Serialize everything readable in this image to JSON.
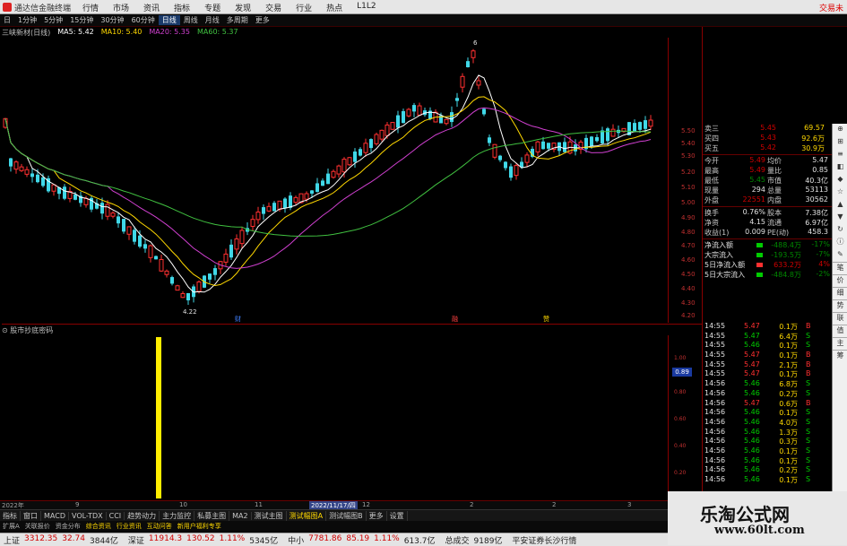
{
  "titlebar": {
    "app_title": "通达信金融终端",
    "menus": [
      "行情",
      "市场",
      "资讯",
      "指标",
      "专题",
      "发现",
      "交易",
      "行业",
      "热点",
      "L1L2"
    ],
    "trade_label": "交易未"
  },
  "periods": [
    "日",
    "1分钟",
    "5分钟",
    "15分钟",
    "30分钟",
    "60分钟",
    "日线",
    "周线",
    "月线",
    "多周期",
    "更多"
  ],
  "active_period": "日线",
  "ma_legend": {
    "stock": "三峡新材(日线)",
    "ma5": "MA5: 5.42",
    "ma10": "MA10: 5.40",
    "ma20": "MA20: 5.35",
    "ma60": "MA60: 5.37"
  },
  "colors": {
    "up": "#ff3030",
    "down": "#40d8e8",
    "ma5": "#ffffff",
    "ma10": "#ffd800",
    "ma20": "#d040d0",
    "ma60": "#40c040"
  },
  "price_scale": [
    "5.50",
    "5.40",
    "5.30",
    "5.20",
    "5.10",
    "5.00",
    "4.90",
    "4.80",
    "4.70",
    "4.60",
    "4.50",
    "4.40",
    "4.30",
    "4.20"
  ],
  "chart_annotations": {
    "low_label": "4.22",
    "high_label": "6",
    "markers": [
      "财",
      "融",
      "赞"
    ]
  },
  "indicator_label": "股市抄底密码",
  "sub_scale": {
    "badge": "0.89",
    "ticks": [
      "1.00",
      "0.80",
      "0.60",
      "0.40",
      "0.20"
    ]
  },
  "dates": {
    "start": "2022年",
    "m9": "9",
    "m10": "10",
    "m11": "11",
    "cursor": "2022/11/17/四",
    "m12": "12",
    "y2023": "2",
    "m2": "2",
    "m3": "3"
  },
  "tabs": [
    "指标",
    "窗口",
    "MACD",
    "VOL-TDX",
    "CCI",
    "趋势动力",
    "主力监控",
    "私募主图",
    "MA2",
    "测试主图",
    "测试幅图A",
    "测试幅图B",
    "更多",
    "设置"
  ],
  "subtabs": [
    "扩展A",
    "关联报价",
    "资金分布",
    "综合资讯",
    "行业资讯",
    "互动问答",
    "新用户福利专享"
  ],
  "status": {
    "sh": {
      "name": "上证",
      "value": "3312.35",
      "chg": "32.74",
      "pct": "",
      "vol": "3844亿"
    },
    "sz": {
      "name": "深证",
      "value": "11914.3",
      "chg": "130.52",
      "pct": "1.11%",
      "vol": "5345亿"
    },
    "zx": {
      "name": "中小",
      "value": "7781.86",
      "chg": "85.19",
      "pct": "1.11%",
      "vol": "613.7亿"
    },
    "total": {
      "name": "总成交",
      "value": "9189亿"
    },
    "broker": "平安证券长沙行情"
  },
  "quote": {
    "asks": [
      {
        "label": "卖三",
        "price": "5.45",
        "vol": "69.57"
      },
      {
        "label": "买四",
        "price": "5.43",
        "vol": "92.6万"
      },
      {
        "label": "买五",
        "price": "5.42",
        "vol": "30.9万"
      }
    ],
    "pairs": [
      {
        "l1": "今开",
        "v1": "5.49",
        "l2": "均价",
        "v2": "5.47"
      },
      {
        "l1": "最高",
        "v1": "5.49",
        "l2": "量比",
        "v2": "0.85"
      },
      {
        "l1": "最低",
        "v1": "5.45",
        "l2": "市值",
        "v2": "40.3亿"
      },
      {
        "l1": "现量",
        "v1": "294",
        "l2": "总量",
        "v2": "53113"
      },
      {
        "l1": "外盘",
        "v1": "22551",
        "l2": "内盘",
        "v2": "30562"
      }
    ],
    "pairs2": [
      {
        "l1": "换手",
        "v1": "0.76%",
        "l2": "股本",
        "v2": "7.38亿"
      },
      {
        "l1": "净资",
        "v1": "4.15",
        "l2": "流通",
        "v2": "6.97亿"
      },
      {
        "l1": "收益(1)",
        "v1": "0.009",
        "l2": "PE(动)",
        "v2": "458.3"
      }
    ],
    "flows": [
      {
        "label": "净流入额",
        "val": "-488.4万",
        "pct": "-17%",
        "color": "green"
      },
      {
        "label": "大宗流入",
        "val": "-193.5万",
        "pct": "-7%",
        "color": "green"
      },
      {
        "label": "5日净流入额",
        "val": "633.2万",
        "pct": "4%",
        "color": "red"
      },
      {
        "label": "5日大宗流入",
        "val": "-484.8万",
        "pct": "-2%",
        "color": "green"
      }
    ]
  },
  "ticks": [
    {
      "t": "14:55",
      "p": "5.47",
      "q": "0.1万",
      "d": "B"
    },
    {
      "t": "14:55",
      "p": "5.47",
      "q": "6.4万",
      "d": "S"
    },
    {
      "t": "14:55",
      "p": "5.46",
      "q": "0.1万",
      "d": "S"
    },
    {
      "t": "14:55",
      "p": "5.47",
      "q": "0.1万",
      "d": "B"
    },
    {
      "t": "14:55",
      "p": "5.47",
      "q": "2.1万",
      "d": "B"
    },
    {
      "t": "14:55",
      "p": "5.47",
      "q": "0.1万",
      "d": "B"
    },
    {
      "t": "14:56",
      "p": "5.46",
      "q": "6.8万",
      "d": "S"
    },
    {
      "t": "14:56",
      "p": "5.46",
      "q": "0.2万",
      "d": "S"
    },
    {
      "t": "14:56",
      "p": "5.47",
      "q": "0.6万",
      "d": "B"
    },
    {
      "t": "14:56",
      "p": "5.46",
      "q": "0.1万",
      "d": "S"
    },
    {
      "t": "14:56",
      "p": "5.46",
      "q": "4.0万",
      "d": "S"
    },
    {
      "t": "14:56",
      "p": "5.46",
      "q": "1.3万",
      "d": "S"
    },
    {
      "t": "14:56",
      "p": "5.46",
      "q": "0.3万",
      "d": "S"
    },
    {
      "t": "14:56",
      "p": "5.46",
      "q": "0.1万",
      "d": "S"
    },
    {
      "t": "14:56",
      "p": "5.46",
      "q": "0.1万",
      "d": "S"
    },
    {
      "t": "14:56",
      "p": "5.46",
      "q": "0.2万",
      "d": "S"
    },
    {
      "t": "14:56",
      "p": "5.46",
      "q": "0.1万",
      "d": "S"
    }
  ],
  "rightstrip_tabs": [
    "笔",
    "价",
    "细",
    "势",
    "联",
    "值",
    "主",
    "筹"
  ],
  "watermark": {
    "t1": "乐淘公式网",
    "t2": "www.60lt.com"
  }
}
